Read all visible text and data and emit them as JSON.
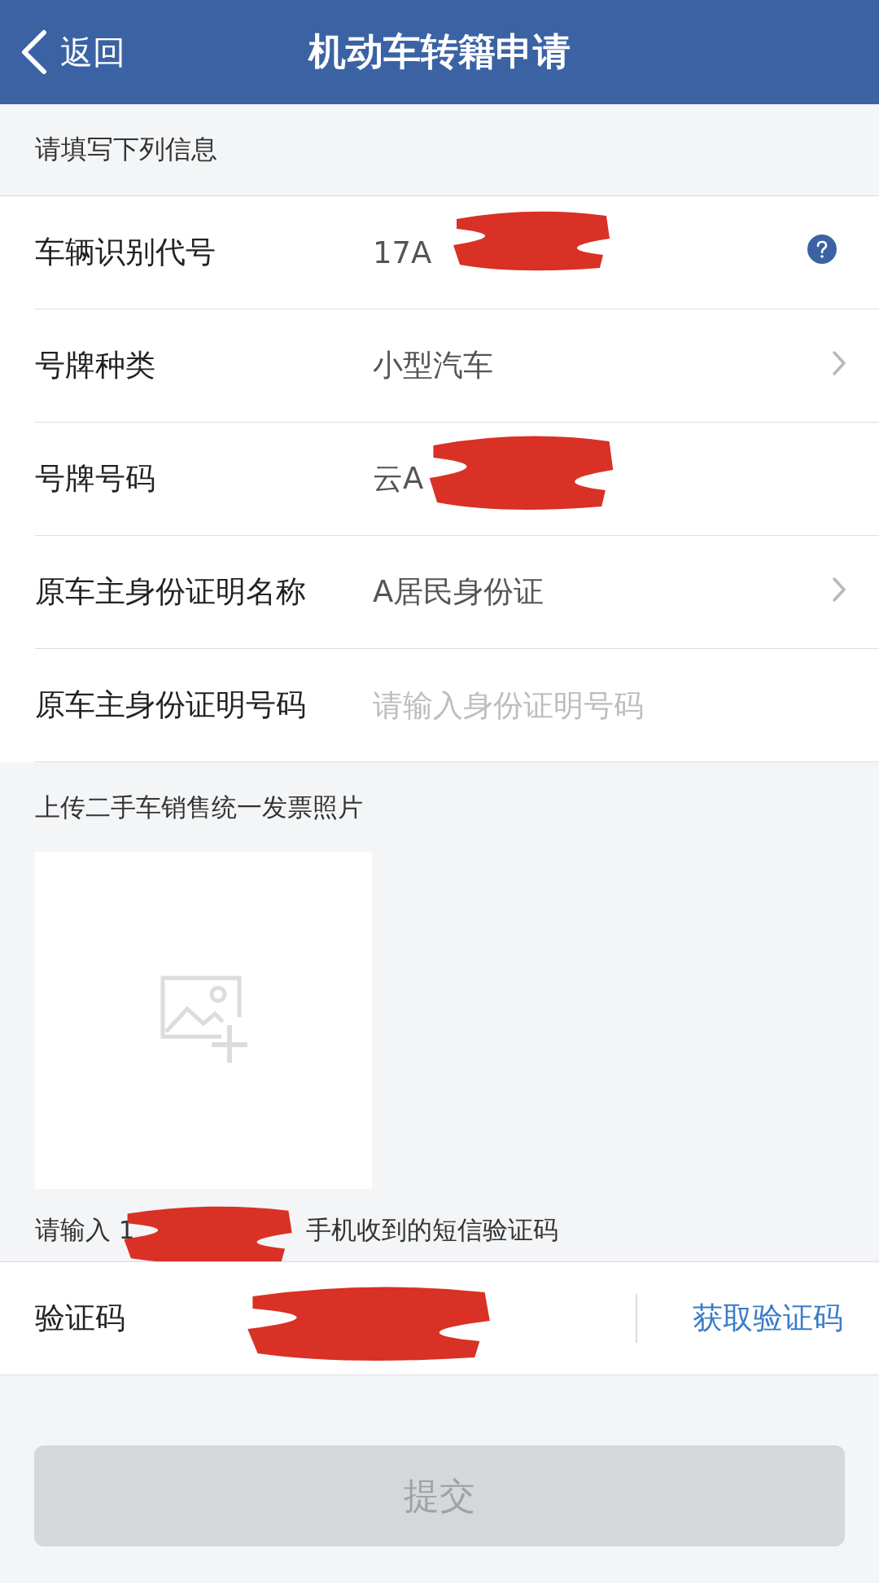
{
  "header": {
    "back_label": "返回",
    "title": "机动车转籍申请"
  },
  "form_hint": "请填写下列信息",
  "fields": [
    {
      "label": "车辆识别代号",
      "value": "17A",
      "kind": "help",
      "redacted": true
    },
    {
      "label": "号牌种类",
      "value": "小型汽车",
      "kind": "select"
    },
    {
      "label": "号牌号码",
      "value": "云A",
      "kind": "text",
      "redacted": true
    },
    {
      "label": "原车主身份证明名称",
      "value": "A居民身份证",
      "kind": "select"
    },
    {
      "label": "原车主身份证明号码",
      "placeholder": "请输入身份证明号码",
      "kind": "input"
    }
  ],
  "upload": {
    "title": "上传二手车销售统一发票照片"
  },
  "sms_hint": {
    "prefix": "请输入 1",
    "suffix": "手机收到的短信验证码",
    "redacted": true
  },
  "code_row": {
    "label": "验证码",
    "redacted": true,
    "link": "获取验证码"
  },
  "submit": {
    "label": "提交",
    "disabled": true
  }
}
